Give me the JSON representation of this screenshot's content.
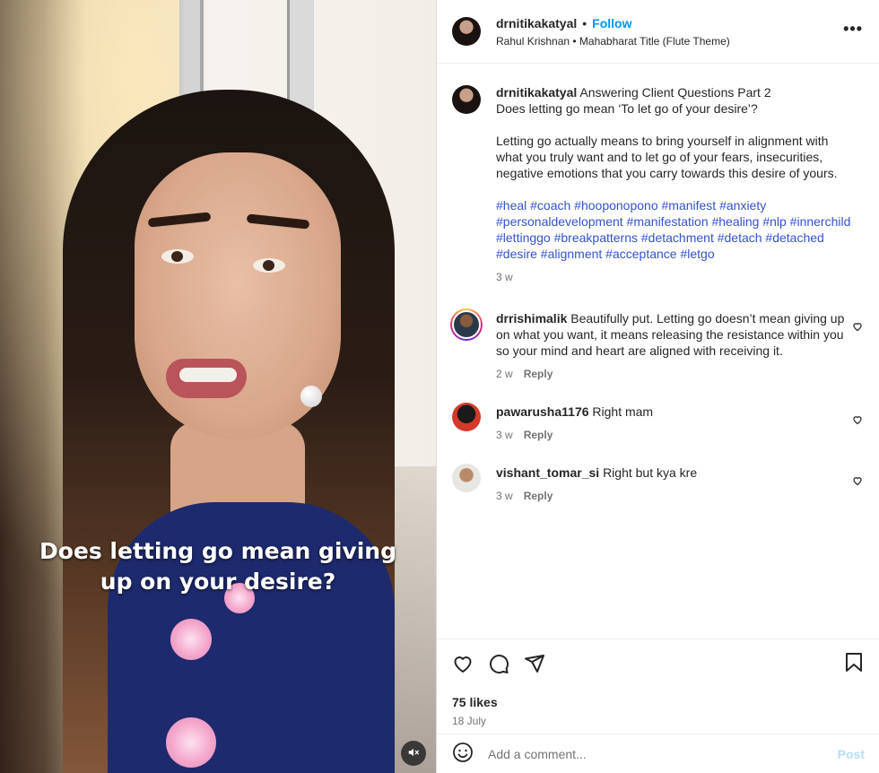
{
  "media": {
    "overlay_line1": "Does letting go mean giving",
    "overlay_line2": "up on your desire?",
    "mute_icon": "speaker-muted-icon"
  },
  "header": {
    "username": "drnitikakatyal",
    "separator": "•",
    "follow_label": "Follow",
    "audio": "Rahul Krishnan • Mahabharat Title (Flute Theme)",
    "more_label": "•••"
  },
  "caption": {
    "username": "drnitikakatyal",
    "text_line1": "Answering Client Questions Part 2",
    "text_line2": "Does letting go mean ‘To let go of your desire’?",
    "paragraph": "Letting go actually means to bring yourself in alignment with what you truly want and to let go of your fears, insecurities, negative emotions that you carry towards this desire of yours.",
    "hashtags": "#heal #coach #hooponopono #manifest #anxiety #personaldevelopment #manifestation #healing #nlp #innerchild #lettinggo #breakpatterns #detachment #detach #detached #desire #alignment #acceptance #letgo",
    "time": "3 w"
  },
  "comments": [
    {
      "username": "drrishimalik",
      "text": "Beautifully put. Letting go doesn’t mean giving up on what you want, it means releasing the resistance within you so your mind and heart are aligned with receiving it.",
      "time": "2 w",
      "reply": "Reply"
    },
    {
      "username": "pawarusha1176",
      "text": "Right mam",
      "time": "3 w",
      "reply": "Reply"
    },
    {
      "username": "vishant_tomar_si",
      "text": "Right but kya kre",
      "time": "3 w",
      "reply": "Reply"
    }
  ],
  "actions": {
    "likes": "75 likes",
    "date": "18 July"
  },
  "add_comment": {
    "placeholder": "Add a comment...",
    "post_label": "Post"
  },
  "colors": {
    "link": "#0095f6",
    "hashtag": "#3552c9",
    "muted": "#737373",
    "post_disabled": "#b2dffc"
  }
}
